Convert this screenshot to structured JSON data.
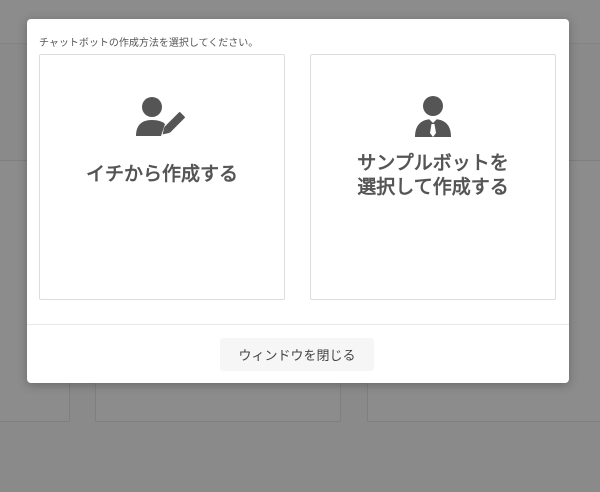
{
  "modal": {
    "description": "チャットボットの作成方法を選択してください。",
    "options": [
      {
        "lines": [
          "イチから作成する"
        ],
        "icon": "user-edit-icon"
      },
      {
        "lines": [
          "サンプルボットを",
          "選択して作成する"
        ],
        "icon": "user-tie-icon"
      }
    ],
    "close_label": "ウィンドウを閉じる"
  },
  "colors": {
    "icon": "#555555",
    "overlay": "#464646",
    "modal_bg": "#ffffff"
  }
}
